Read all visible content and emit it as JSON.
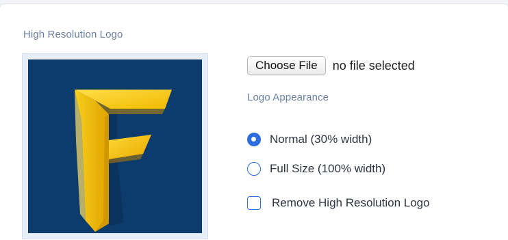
{
  "hires_logo": {
    "label": "High Resolution Logo",
    "image_icon": "letter-f-logo"
  },
  "file_input": {
    "button_label": "Choose File",
    "status_text": "no file selected"
  },
  "appearance": {
    "label": "Logo Appearance",
    "options": [
      {
        "label": "Normal (30% width)",
        "selected": true
      },
      {
        "label": "Full Size (100% width)",
        "selected": false
      }
    ]
  },
  "remove_option": {
    "label": "Remove High Resolution Logo",
    "checked": false
  },
  "colors": {
    "label_text": "#6b7fa3",
    "accent": "#2d6cdf",
    "logo_background": "#0d3b6b",
    "logo_gold": "#f2c20f"
  }
}
